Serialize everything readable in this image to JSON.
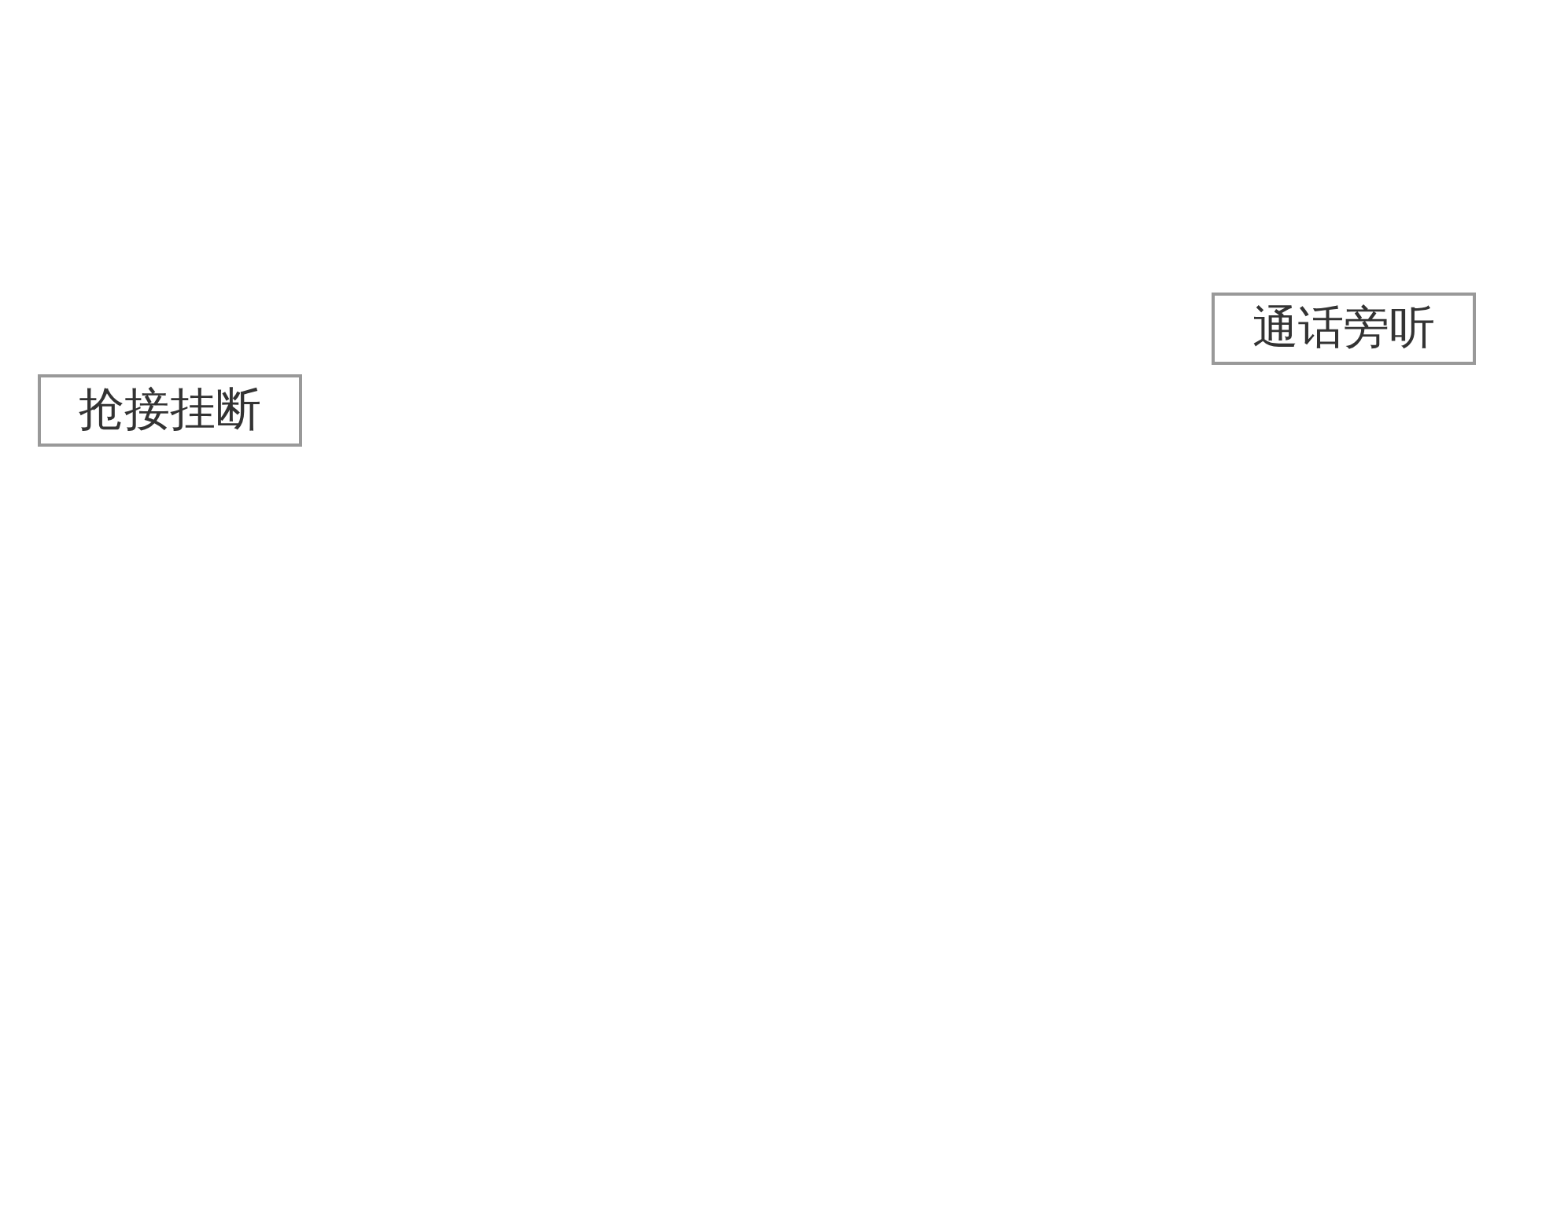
{
  "buttons": [
    {
      "label": "通话旁听"
    },
    {
      "label": "抢接挂断"
    }
  ]
}
